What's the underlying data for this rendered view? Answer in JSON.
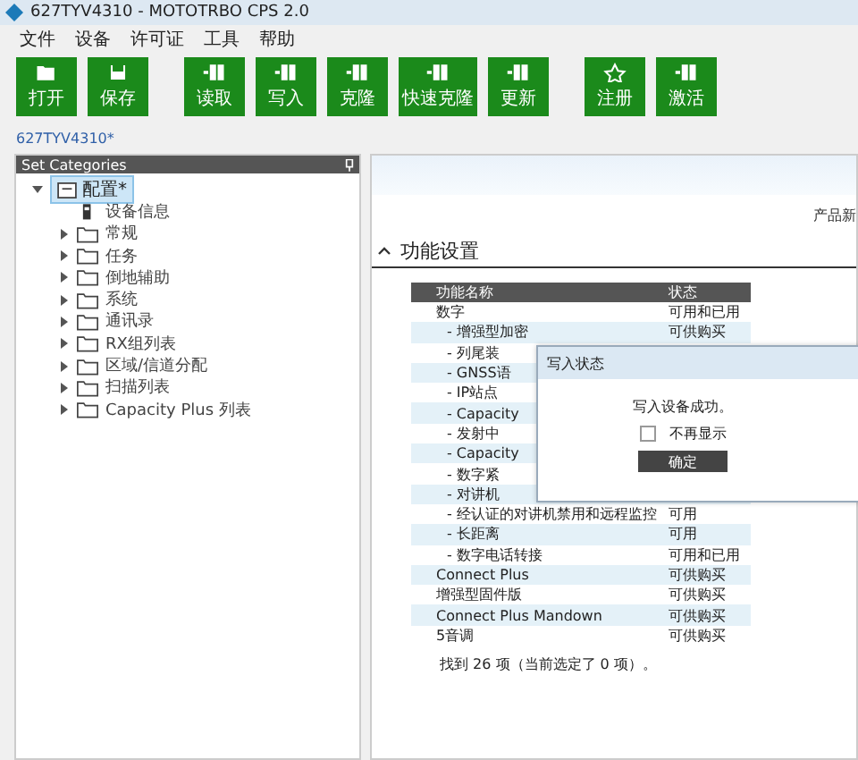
{
  "window": {
    "title": "627TYV4310 - MOTOTRBO CPS 2.0"
  },
  "menu": [
    "文件",
    "设备",
    "许可证",
    "工具",
    "帮助"
  ],
  "toolbar": [
    "打开",
    "保存",
    "读取",
    "写入",
    "克隆",
    "快速克隆",
    "更新",
    "注册",
    "激活"
  ],
  "breadcrumb": "627TYV4310*",
  "sidebar": {
    "title": "Set Categories",
    "tree": {
      "label": "配置*",
      "expanded": true,
      "selected": true,
      "children": [
        {
          "label": "设备信息",
          "kind": "device"
        },
        {
          "label": "常规",
          "kind": "folder",
          "expanded": false
        },
        {
          "label": "任务",
          "kind": "folder",
          "expanded": false
        },
        {
          "label": "倒地辅助",
          "kind": "folder",
          "expanded": false
        },
        {
          "label": "系统",
          "kind": "folder",
          "expanded": false
        },
        {
          "label": "通讯录",
          "kind": "folder",
          "expanded": false
        },
        {
          "label": "RX组列表",
          "kind": "folder",
          "expanded": false
        },
        {
          "label": "区域/信道分配",
          "kind": "folder",
          "expanded": false
        },
        {
          "label": "扫描列表",
          "kind": "folder",
          "expanded": false
        },
        {
          "label": "Capacity Plus 列表",
          "kind": "folder",
          "expanded": false
        }
      ]
    }
  },
  "content": {
    "header_text": "产品新",
    "section": {
      "title": "功能设置",
      "expanded": true
    },
    "table": {
      "columns": [
        "功能名称",
        "状态"
      ],
      "rows": [
        {
          "name": "数字",
          "status": "可用和已用",
          "children": [
            {
              "name": "- 增强型加密",
              "status": "可供购买"
            },
            {
              "name": "- 列尾装"
            },
            {
              "name": "- GNSS语"
            },
            {
              "name": "- IP站点"
            },
            {
              "name": "- Capacity"
            },
            {
              "name": "- 发射中"
            },
            {
              "name": "- Capacity"
            },
            {
              "name": "- 数字紧"
            },
            {
              "name": "- 对讲机"
            },
            {
              "name": "- 经认证的对讲机禁用和远程监控",
              "status": "可用"
            },
            {
              "name": "- 长距离",
              "status": "可用"
            },
            {
              "name": "- 数字电话转接",
              "status": "可用和已用"
            }
          ]
        },
        {
          "name": "Connect Plus",
          "status": "可供购买"
        },
        {
          "name": "增强型固件版",
          "status": "可供购买"
        },
        {
          "name": "Connect Plus Mandown",
          "status": "可供购买"
        },
        {
          "name": "5音调",
          "status": "可供购买"
        }
      ]
    },
    "status": "找到 26 项（当前选定了 0 项）。"
  },
  "dialog": {
    "title": "写入状态",
    "message": "写入设备成功。",
    "checkbox": {
      "label": "不再显示",
      "checked": false
    },
    "button": "确定"
  }
}
